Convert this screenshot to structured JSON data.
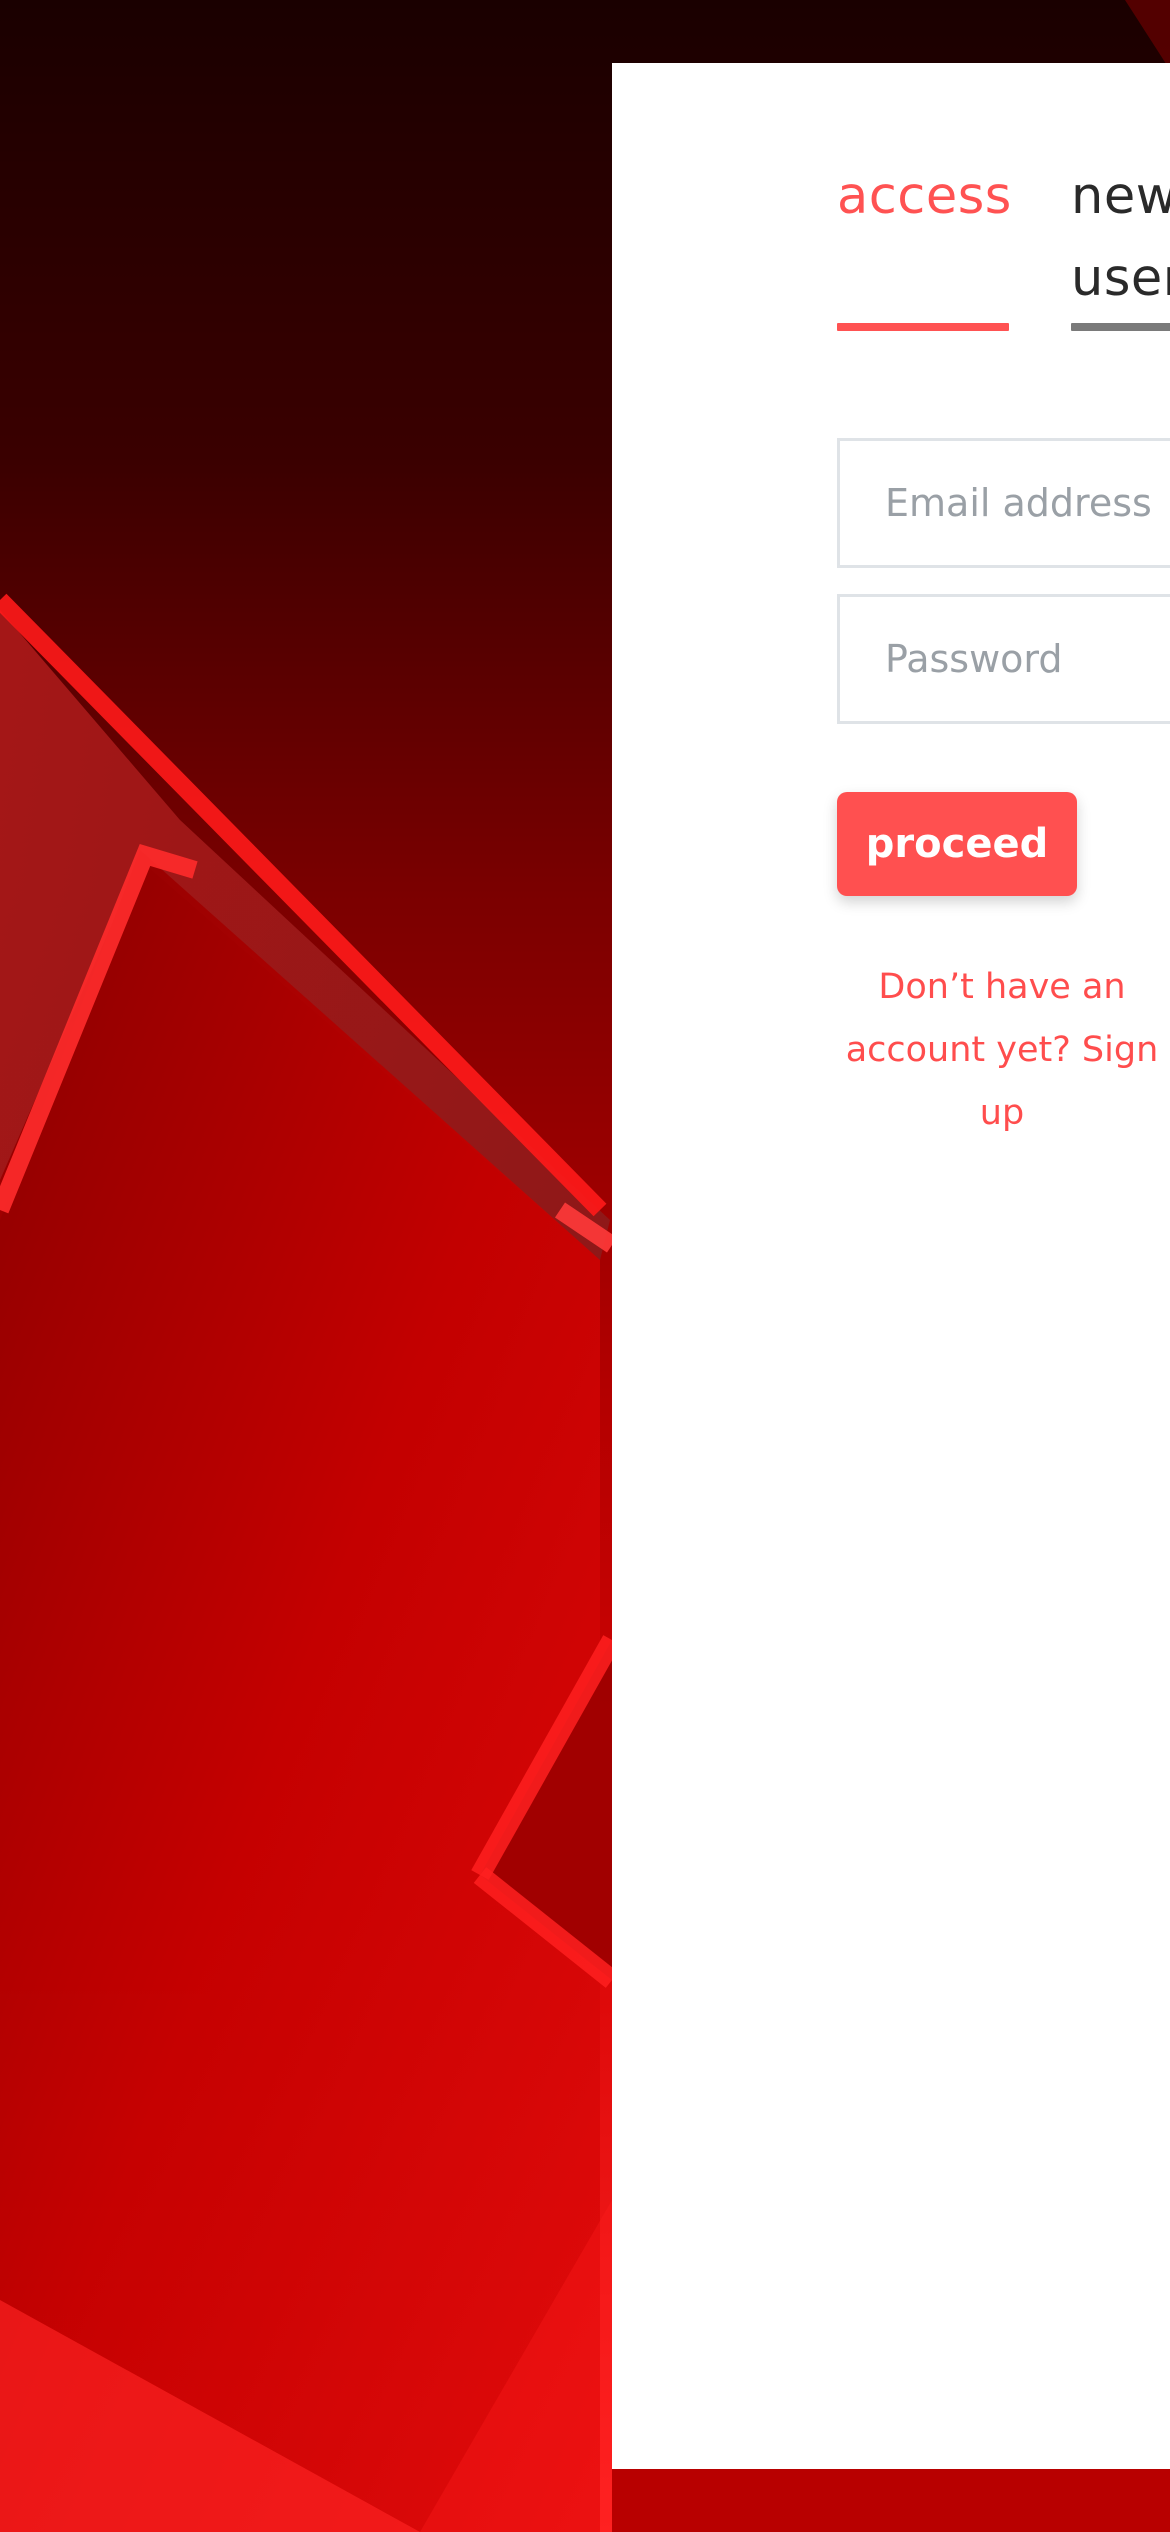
{
  "colors": {
    "accent": "#ff5252",
    "button_bg": "#ff5050",
    "panel_bg": "#ffffff",
    "inactive_underline": "#7a7a7a",
    "input_border": "#dfe3e7",
    "placeholder": "#9aa0a6",
    "background_dark": "#1a0000",
    "background_red": "#e10e0e"
  },
  "auth": {
    "tabs": {
      "active_label": "access",
      "inactive_label": "new user"
    },
    "email": {
      "placeholder": "Email address",
      "value": ""
    },
    "password": {
      "placeholder": "Password",
      "value": ""
    },
    "submit_label": "proceed",
    "signup_text": "Don’t have an account yet? Sign up"
  }
}
